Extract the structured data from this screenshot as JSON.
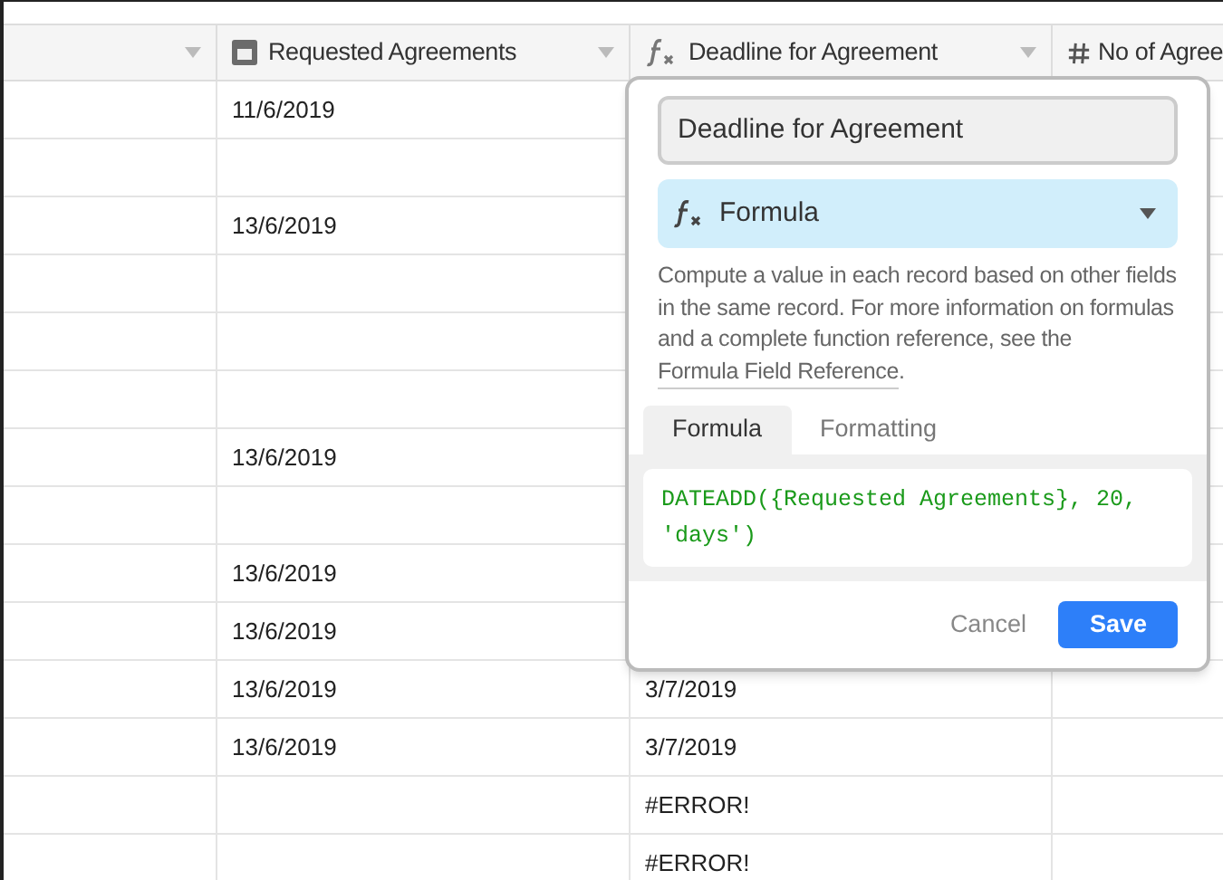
{
  "table": {
    "columns": [
      {
        "kind": "blank"
      },
      {
        "label": "Requested Agreements",
        "kind": "date"
      },
      {
        "label": "Deadline for Agreement",
        "kind": "formula"
      },
      {
        "label": "No of Agree",
        "kind": "number"
      }
    ],
    "rows": [
      [
        "",
        "11/6/2019",
        "",
        ""
      ],
      [
        "",
        "",
        "",
        ""
      ],
      [
        "",
        "13/6/2019",
        "",
        ""
      ],
      [
        "",
        "",
        "",
        ""
      ],
      [
        "",
        "",
        "",
        ""
      ],
      [
        "",
        "",
        "",
        ""
      ],
      [
        "",
        "13/6/2019",
        "",
        ""
      ],
      [
        "",
        "",
        "",
        ""
      ],
      [
        "",
        "13/6/2019",
        "",
        ""
      ],
      [
        "",
        "13/6/2019",
        "",
        ""
      ],
      [
        "",
        "13/6/2019",
        "3/7/2019",
        ""
      ],
      [
        "",
        "13/6/2019",
        "3/7/2019",
        ""
      ],
      [
        "",
        "",
        "#ERROR!",
        ""
      ],
      [
        "",
        "",
        "#ERROR!",
        ""
      ]
    ]
  },
  "popup": {
    "field_name": "Deadline for Agreement",
    "type_label": "Formula",
    "description": "Compute a value in each record based on other fields in the same record. For more information on formulas and a complete function reference, see the ",
    "link": "Formula Field Reference",
    "description_end": ".",
    "tabs": [
      {
        "label": "Formula",
        "selected": true
      },
      {
        "label": "Formatting",
        "selected": false
      }
    ],
    "formula": "DATEADD({Requested Agreements}, 20, 'days')",
    "buttons": {
      "cancel": "Cancel",
      "save": "Save"
    }
  }
}
